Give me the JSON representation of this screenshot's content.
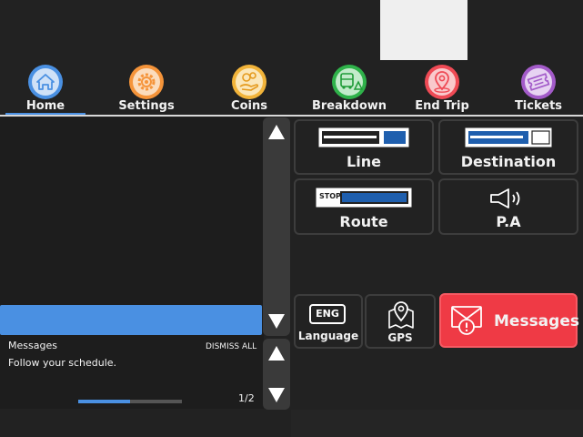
{
  "nav": {
    "items": [
      {
        "label": "Home",
        "icon": "home-icon",
        "color": "#4a90e2"
      },
      {
        "label": "Settings",
        "icon": "gear-icon",
        "color": "#f5943a"
      },
      {
        "label": "Coins",
        "icon": "coins-icon",
        "color": "#f2b43a"
      },
      {
        "label": "Breakdown",
        "icon": "bus-warning-icon",
        "color": "#2fb24a"
      },
      {
        "label": "End Trip",
        "icon": "map-pin-icon",
        "color": "#ef4a55"
      },
      {
        "label": "Tickets",
        "icon": "ticket-icon",
        "color": "#a35bc9"
      }
    ],
    "active": "Home"
  },
  "tiles": {
    "line": {
      "label": "Line"
    },
    "destination": {
      "label": "Destination"
    },
    "route": {
      "label": "Route",
      "stop_label": "STOP"
    },
    "pa": {
      "label": "P.A"
    },
    "language": {
      "label": "Language",
      "code": "ENG"
    },
    "gps": {
      "label": "GPS"
    },
    "messages": {
      "label": "Messages"
    }
  },
  "messages_panel": {
    "title": "Messages",
    "dismiss_label": "DISMISS ALL",
    "text": "Follow your schedule.",
    "page": "1/2",
    "progress": 0.5
  },
  "colors": {
    "background": "#222222",
    "accent_blue": "#4a90e2",
    "alert_red": "#ef3a45"
  }
}
